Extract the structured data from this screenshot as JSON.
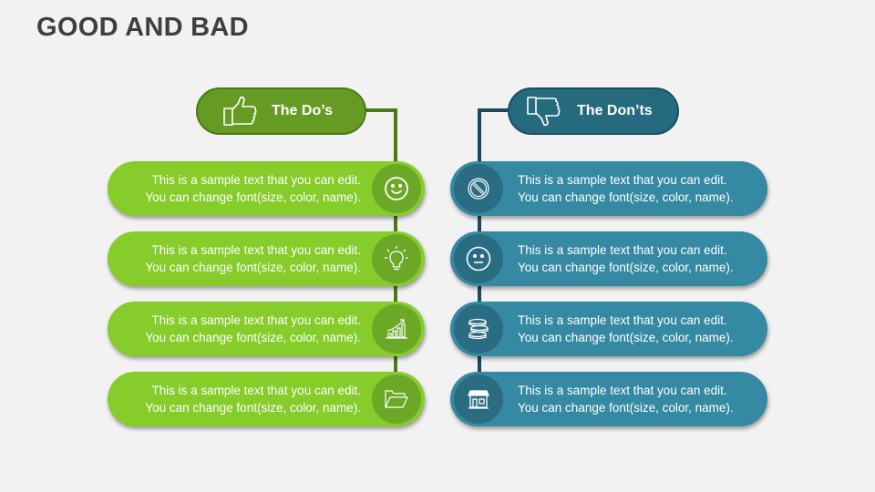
{
  "title": "GOOD AND BAD",
  "colors": {
    "do_header": "#659b22",
    "do_item": "#86cc2b",
    "do_circle": "#6aa825",
    "do_line": "#4b7a17",
    "dont_header": "#266a7e",
    "dont_item": "#3589a3",
    "dont_circle": "#2a6c82",
    "dont_line": "#1b4a5c"
  },
  "dos": {
    "header": {
      "label": "The Do’s",
      "icon": "thumbs-up-icon"
    },
    "items": [
      {
        "line1": "This is a sample text that you can edit.",
        "line2": "You can change font(size, color, name).",
        "icon": "smiley-face-icon"
      },
      {
        "line1": "This is a sample text that you can edit.",
        "line2": "You can change font(size, color, name).",
        "icon": "lightbulb-icon"
      },
      {
        "line1": "This is a sample text that you can edit.",
        "line2": "You can change font(size, color, name).",
        "icon": "growth-chart-icon"
      },
      {
        "line1": "This is a sample text that you can edit.",
        "line2": "You can change font(size, color, name).",
        "icon": "open-folder-icon"
      }
    ]
  },
  "donts": {
    "header": {
      "label": "The Don’ts",
      "icon": "thumbs-down-icon"
    },
    "items": [
      {
        "line1": "This is a sample text that you can edit.",
        "line2": "You can change font(size, color, name).",
        "icon": "prohibited-icon"
      },
      {
        "line1": "This is a sample text that you can edit.",
        "line2": "You can change font(size, color, name).",
        "icon": "neutral-face-icon"
      },
      {
        "line1": "This is a sample text that you can edit.",
        "line2": "You can change font(size, color, name).",
        "icon": "coin-stack-icon"
      },
      {
        "line1": "This is a sample text that you can edit.",
        "line2": "You can change font(size, color, name).",
        "icon": "storefront-icon"
      }
    ]
  }
}
